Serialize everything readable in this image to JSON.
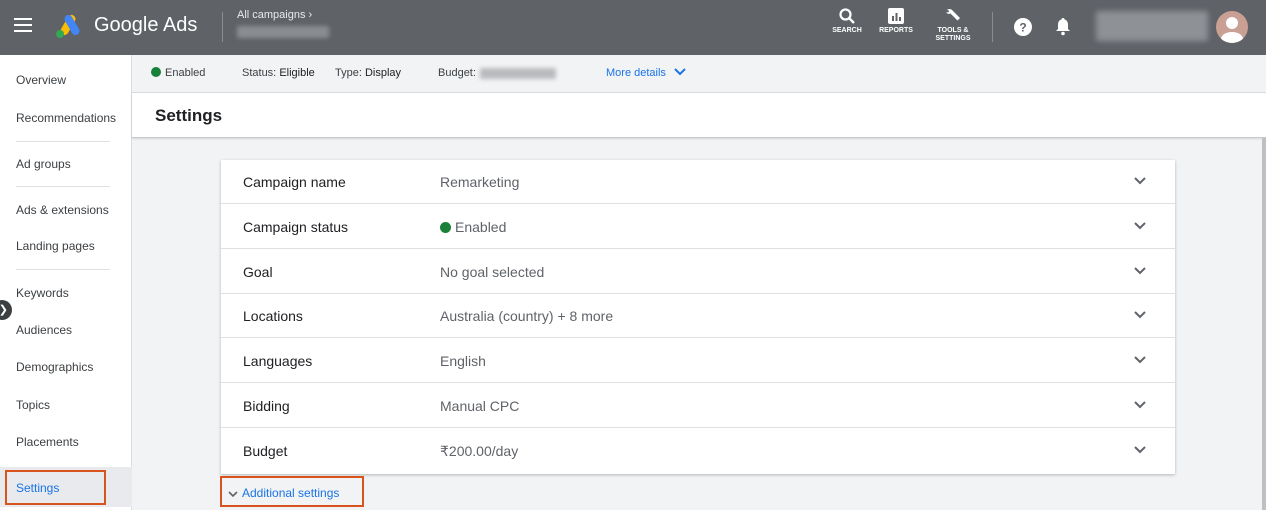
{
  "header": {
    "brand": "Google Ads",
    "breadcrumb": "All campaigns  ›",
    "tools": [
      {
        "label": "SEARCH",
        "icon": "search-icon"
      },
      {
        "label": "REPORTS",
        "icon": "reports-icon"
      },
      {
        "label": "TOOLS &",
        "label2": "SETTINGS",
        "icon": "wrench-icon"
      }
    ]
  },
  "sidebar": {
    "items": [
      {
        "label": "Overview"
      },
      {
        "label": "Recommendations"
      },
      {
        "label": "Ad groups"
      },
      {
        "label": "Ads & extensions"
      },
      {
        "label": "Landing pages"
      },
      {
        "label": "Keywords"
      },
      {
        "label": "Audiences"
      },
      {
        "label": "Demographics"
      },
      {
        "label": "Topics"
      },
      {
        "label": "Placements"
      },
      {
        "label": "Settings"
      }
    ]
  },
  "status_bar": {
    "enabled": "Enabled",
    "status_label": "Status:",
    "status_value": "Eligible",
    "type_label": "Type:",
    "type_value": "Display",
    "budget_label": "Budget:",
    "more_details": "More details"
  },
  "page_title": "Settings",
  "settings": {
    "rows": [
      {
        "label": "Campaign name",
        "value": "Remarketing"
      },
      {
        "label": "Campaign status",
        "value": "Enabled"
      },
      {
        "label": "Goal",
        "value": "No goal selected"
      },
      {
        "label": "Locations",
        "value": "Australia (country) + 8 more"
      },
      {
        "label": "Languages",
        "value": "English"
      },
      {
        "label": "Bidding",
        "value": "Manual CPC"
      },
      {
        "label": "Budget",
        "value": "₹200.00/day"
      }
    ],
    "additional_settings": "Additional settings"
  },
  "colors": {
    "header_bg": "#5f6368",
    "accent_blue": "#1a73e8",
    "enabled_green": "#188038",
    "highlight_orange": "#d9531e"
  }
}
